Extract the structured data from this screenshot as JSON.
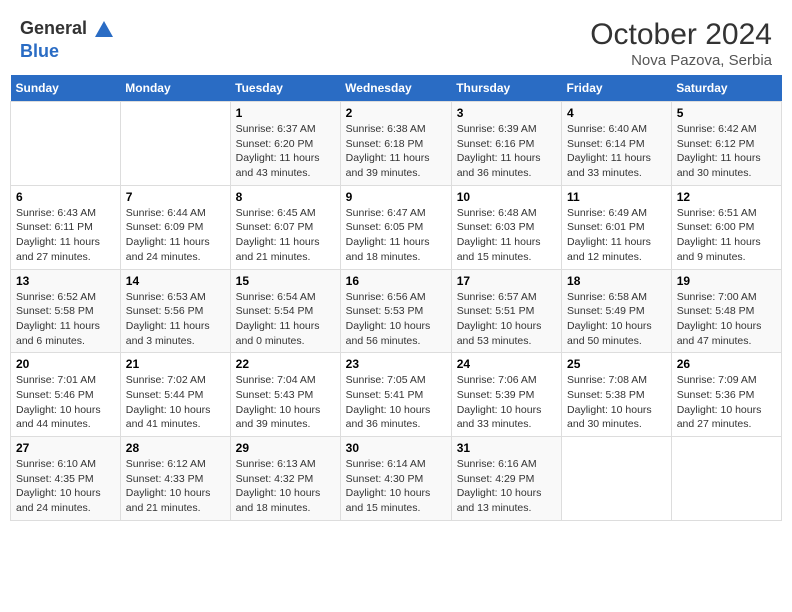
{
  "header": {
    "logo_general": "General",
    "logo_blue": "Blue",
    "month_title": "October 2024",
    "location": "Nova Pazova, Serbia"
  },
  "weekdays": [
    "Sunday",
    "Monday",
    "Tuesday",
    "Wednesday",
    "Thursday",
    "Friday",
    "Saturday"
  ],
  "weeks": [
    [
      {
        "day": "",
        "sunrise": "",
        "sunset": "",
        "daylight": ""
      },
      {
        "day": "",
        "sunrise": "",
        "sunset": "",
        "daylight": ""
      },
      {
        "day": "1",
        "sunrise": "Sunrise: 6:37 AM",
        "sunset": "Sunset: 6:20 PM",
        "daylight": "Daylight: 11 hours and 43 minutes."
      },
      {
        "day": "2",
        "sunrise": "Sunrise: 6:38 AM",
        "sunset": "Sunset: 6:18 PM",
        "daylight": "Daylight: 11 hours and 39 minutes."
      },
      {
        "day": "3",
        "sunrise": "Sunrise: 6:39 AM",
        "sunset": "Sunset: 6:16 PM",
        "daylight": "Daylight: 11 hours and 36 minutes."
      },
      {
        "day": "4",
        "sunrise": "Sunrise: 6:40 AM",
        "sunset": "Sunset: 6:14 PM",
        "daylight": "Daylight: 11 hours and 33 minutes."
      },
      {
        "day": "5",
        "sunrise": "Sunrise: 6:42 AM",
        "sunset": "Sunset: 6:12 PM",
        "daylight": "Daylight: 11 hours and 30 minutes."
      }
    ],
    [
      {
        "day": "6",
        "sunrise": "Sunrise: 6:43 AM",
        "sunset": "Sunset: 6:11 PM",
        "daylight": "Daylight: 11 hours and 27 minutes."
      },
      {
        "day": "7",
        "sunrise": "Sunrise: 6:44 AM",
        "sunset": "Sunset: 6:09 PM",
        "daylight": "Daylight: 11 hours and 24 minutes."
      },
      {
        "day": "8",
        "sunrise": "Sunrise: 6:45 AM",
        "sunset": "Sunset: 6:07 PM",
        "daylight": "Daylight: 11 hours and 21 minutes."
      },
      {
        "day": "9",
        "sunrise": "Sunrise: 6:47 AM",
        "sunset": "Sunset: 6:05 PM",
        "daylight": "Daylight: 11 hours and 18 minutes."
      },
      {
        "day": "10",
        "sunrise": "Sunrise: 6:48 AM",
        "sunset": "Sunset: 6:03 PM",
        "daylight": "Daylight: 11 hours and 15 minutes."
      },
      {
        "day": "11",
        "sunrise": "Sunrise: 6:49 AM",
        "sunset": "Sunset: 6:01 PM",
        "daylight": "Daylight: 11 hours and 12 minutes."
      },
      {
        "day": "12",
        "sunrise": "Sunrise: 6:51 AM",
        "sunset": "Sunset: 6:00 PM",
        "daylight": "Daylight: 11 hours and 9 minutes."
      }
    ],
    [
      {
        "day": "13",
        "sunrise": "Sunrise: 6:52 AM",
        "sunset": "Sunset: 5:58 PM",
        "daylight": "Daylight: 11 hours and 6 minutes."
      },
      {
        "day": "14",
        "sunrise": "Sunrise: 6:53 AM",
        "sunset": "Sunset: 5:56 PM",
        "daylight": "Daylight: 11 hours and 3 minutes."
      },
      {
        "day": "15",
        "sunrise": "Sunrise: 6:54 AM",
        "sunset": "Sunset: 5:54 PM",
        "daylight": "Daylight: 11 hours and 0 minutes."
      },
      {
        "day": "16",
        "sunrise": "Sunrise: 6:56 AM",
        "sunset": "Sunset: 5:53 PM",
        "daylight": "Daylight: 10 hours and 56 minutes."
      },
      {
        "day": "17",
        "sunrise": "Sunrise: 6:57 AM",
        "sunset": "Sunset: 5:51 PM",
        "daylight": "Daylight: 10 hours and 53 minutes."
      },
      {
        "day": "18",
        "sunrise": "Sunrise: 6:58 AM",
        "sunset": "Sunset: 5:49 PM",
        "daylight": "Daylight: 10 hours and 50 minutes."
      },
      {
        "day": "19",
        "sunrise": "Sunrise: 7:00 AM",
        "sunset": "Sunset: 5:48 PM",
        "daylight": "Daylight: 10 hours and 47 minutes."
      }
    ],
    [
      {
        "day": "20",
        "sunrise": "Sunrise: 7:01 AM",
        "sunset": "Sunset: 5:46 PM",
        "daylight": "Daylight: 10 hours and 44 minutes."
      },
      {
        "day": "21",
        "sunrise": "Sunrise: 7:02 AM",
        "sunset": "Sunset: 5:44 PM",
        "daylight": "Daylight: 10 hours and 41 minutes."
      },
      {
        "day": "22",
        "sunrise": "Sunrise: 7:04 AM",
        "sunset": "Sunset: 5:43 PM",
        "daylight": "Daylight: 10 hours and 39 minutes."
      },
      {
        "day": "23",
        "sunrise": "Sunrise: 7:05 AM",
        "sunset": "Sunset: 5:41 PM",
        "daylight": "Daylight: 10 hours and 36 minutes."
      },
      {
        "day": "24",
        "sunrise": "Sunrise: 7:06 AM",
        "sunset": "Sunset: 5:39 PM",
        "daylight": "Daylight: 10 hours and 33 minutes."
      },
      {
        "day": "25",
        "sunrise": "Sunrise: 7:08 AM",
        "sunset": "Sunset: 5:38 PM",
        "daylight": "Daylight: 10 hours and 30 minutes."
      },
      {
        "day": "26",
        "sunrise": "Sunrise: 7:09 AM",
        "sunset": "Sunset: 5:36 PM",
        "daylight": "Daylight: 10 hours and 27 minutes."
      }
    ],
    [
      {
        "day": "27",
        "sunrise": "Sunrise: 6:10 AM",
        "sunset": "Sunset: 4:35 PM",
        "daylight": "Daylight: 10 hours and 24 minutes."
      },
      {
        "day": "28",
        "sunrise": "Sunrise: 6:12 AM",
        "sunset": "Sunset: 4:33 PM",
        "daylight": "Daylight: 10 hours and 21 minutes."
      },
      {
        "day": "29",
        "sunrise": "Sunrise: 6:13 AM",
        "sunset": "Sunset: 4:32 PM",
        "daylight": "Daylight: 10 hours and 18 minutes."
      },
      {
        "day": "30",
        "sunrise": "Sunrise: 6:14 AM",
        "sunset": "Sunset: 4:30 PM",
        "daylight": "Daylight: 10 hours and 15 minutes."
      },
      {
        "day": "31",
        "sunrise": "Sunrise: 6:16 AM",
        "sunset": "Sunset: 4:29 PM",
        "daylight": "Daylight: 10 hours and 13 minutes."
      },
      {
        "day": "",
        "sunrise": "",
        "sunset": "",
        "daylight": ""
      },
      {
        "day": "",
        "sunrise": "",
        "sunset": "",
        "daylight": ""
      }
    ]
  ]
}
